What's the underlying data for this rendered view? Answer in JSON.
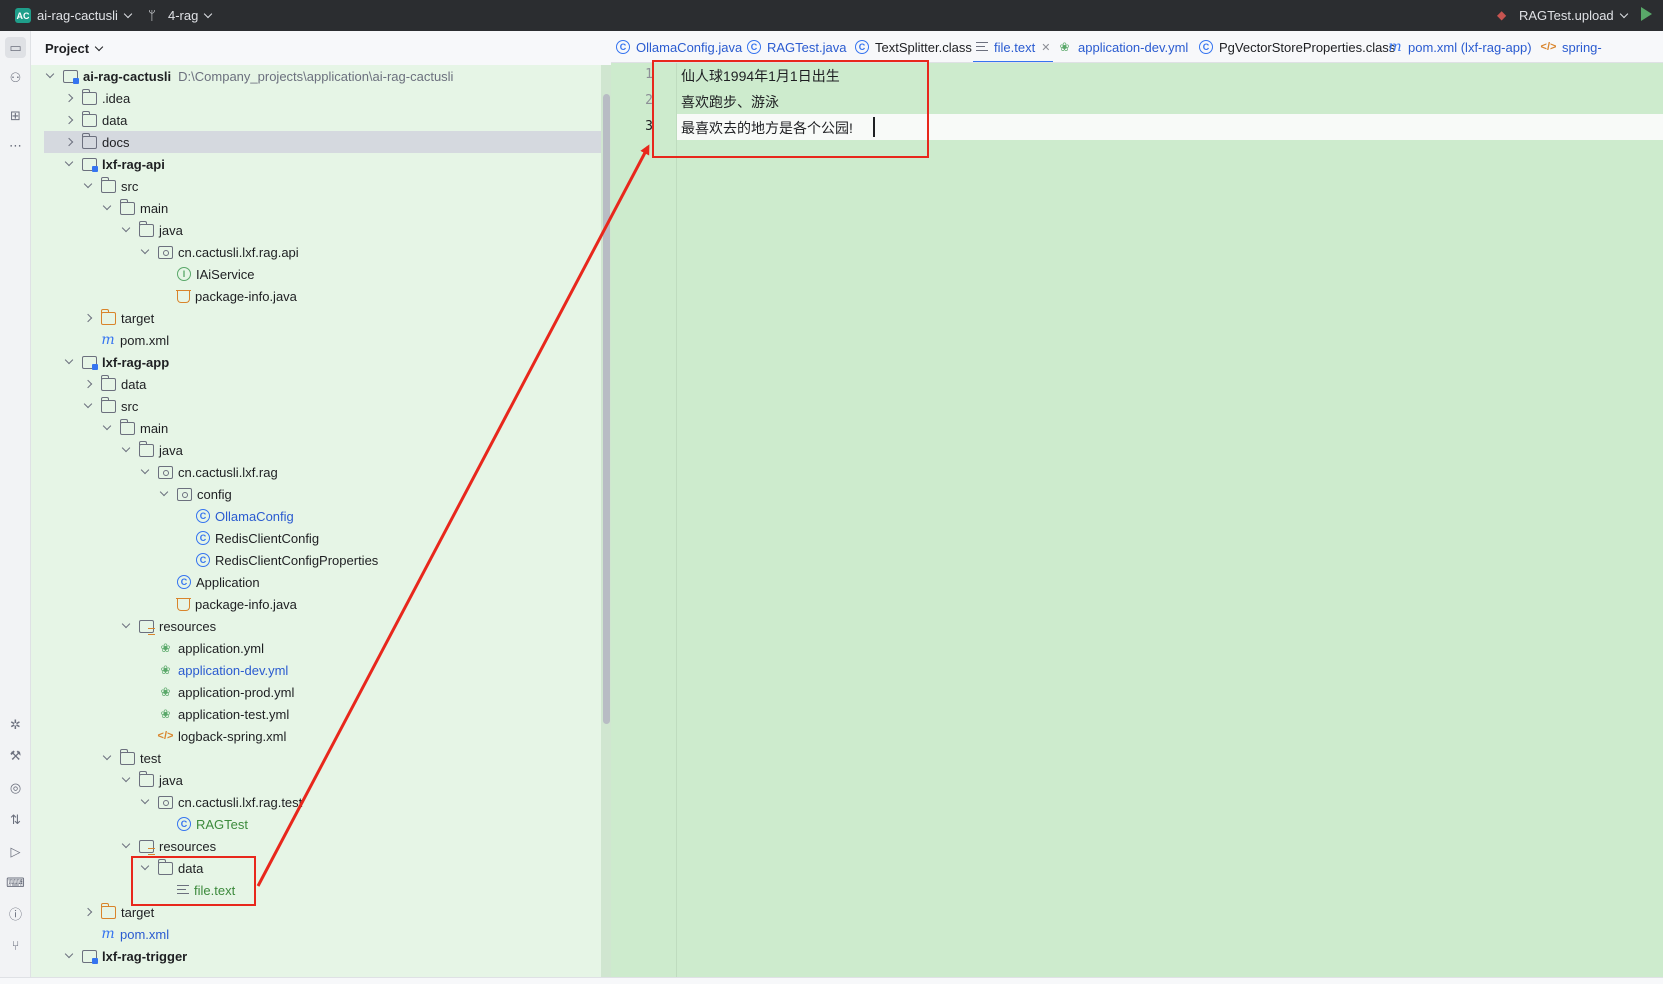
{
  "titlebar": {
    "project_badge": "AC",
    "project_name": "ai-rag-cactusli",
    "branch": "4-rag",
    "run_config": "RAGTest.upload"
  },
  "project_panel": {
    "title": "Project",
    "root_path": "D:\\Company_projects\\application\\ai-rag-cactusli",
    "tree": [
      {
        "label": "ai-rag-cactusli",
        "icon": "module-icon",
        "arrow": "open",
        "bold": true
      },
      {
        "label": ".idea",
        "icon": "folder-icon",
        "arrow": "closed"
      },
      {
        "label": "data",
        "icon": "folder-icon",
        "arrow": "closed"
      },
      {
        "label": "docs",
        "icon": "folder-icon",
        "arrow": "closed",
        "selected": true
      },
      {
        "label": "lxf-rag-api",
        "icon": "module-icon",
        "arrow": "open",
        "bold": true
      },
      {
        "label": "src",
        "icon": "folder-icon",
        "arrow": "open"
      },
      {
        "label": "main",
        "icon": "folder-icon",
        "arrow": "open"
      },
      {
        "label": "java",
        "icon": "folder-icon",
        "arrow": "open"
      },
      {
        "label": "cn.cactusli.lxf.rag.api",
        "icon": "package-icon",
        "arrow": "open"
      },
      {
        "label": "IAiService",
        "icon": "interface-icon",
        "arrow": "none"
      },
      {
        "label": "package-info.java",
        "icon": "java-file-icon",
        "arrow": "none"
      },
      {
        "label": "target",
        "icon": "folder-orange-icon",
        "arrow": "closed"
      },
      {
        "label": "pom.xml",
        "icon": "maven-icon",
        "arrow": "none"
      },
      {
        "label": "lxf-rag-app",
        "icon": "module-icon",
        "arrow": "open",
        "bold": true
      },
      {
        "label": "data",
        "icon": "folder-icon",
        "arrow": "closed"
      },
      {
        "label": "src",
        "icon": "folder-icon",
        "arrow": "open"
      },
      {
        "label": "main",
        "icon": "folder-icon",
        "arrow": "open"
      },
      {
        "label": "java",
        "icon": "folder-icon",
        "arrow": "open"
      },
      {
        "label": "cn.cactusli.lxf.rag",
        "icon": "package-icon",
        "arrow": "open"
      },
      {
        "label": "config",
        "icon": "package-icon",
        "arrow": "open"
      },
      {
        "label": "OllamaConfig",
        "icon": "class-icon",
        "arrow": "none",
        "color": "blue"
      },
      {
        "label": "RedisClientConfig",
        "icon": "class-icon",
        "arrow": "none"
      },
      {
        "label": "RedisClientConfigProperties",
        "icon": "class-icon",
        "arrow": "none"
      },
      {
        "label": "Application",
        "icon": "spring-app-icon",
        "arrow": "none"
      },
      {
        "label": "package-info.java",
        "icon": "java-file-icon",
        "arrow": "none"
      },
      {
        "label": "resources",
        "icon": "resources-icon",
        "arrow": "open"
      },
      {
        "label": "application.yml",
        "icon": "yaml-icon",
        "arrow": "none"
      },
      {
        "label": "application-dev.yml",
        "icon": "yaml-icon",
        "arrow": "none",
        "color": "blue"
      },
      {
        "label": "application-prod.yml",
        "icon": "yaml-icon",
        "arrow": "none"
      },
      {
        "label": "application-test.yml",
        "icon": "yaml-icon",
        "arrow": "none"
      },
      {
        "label": "logback-spring.xml",
        "icon": "xml-icon",
        "arrow": "none"
      },
      {
        "label": "test",
        "icon": "folder-icon",
        "arrow": "open"
      },
      {
        "label": "java",
        "icon": "folder-icon",
        "arrow": "open"
      },
      {
        "label": "cn.cactusli.lxf.rag.test",
        "icon": "package-icon",
        "arrow": "open"
      },
      {
        "label": "RAGTest",
        "icon": "class-icon",
        "arrow": "none",
        "color": "green"
      },
      {
        "label": "resources",
        "icon": "resources-icon",
        "arrow": "open"
      },
      {
        "label": "data",
        "icon": "folder-icon",
        "arrow": "open"
      },
      {
        "label": "file.text",
        "icon": "text-file-icon",
        "arrow": "none",
        "color": "green"
      },
      {
        "label": "target",
        "icon": "folder-orange-icon",
        "arrow": "closed"
      },
      {
        "label": "pom.xml",
        "icon": "maven-icon",
        "arrow": "none",
        "color": "blue"
      },
      {
        "label": "lxf-rag-trigger",
        "icon": "module-icon",
        "arrow": "open",
        "bold": true
      }
    ]
  },
  "editor": {
    "tabs": [
      {
        "label": "OllamaConfig.java",
        "icon": "class-icon",
        "color": "blue"
      },
      {
        "label": "RAGTest.java",
        "icon": "class-icon",
        "color": "blue"
      },
      {
        "label": "TextSplitter.class",
        "icon": "class-icon"
      },
      {
        "label": "file.text",
        "icon": "text-file-icon",
        "active": true,
        "close": "✕"
      },
      {
        "label": "application-dev.yml",
        "icon": "yaml-icon",
        "color": "blue"
      },
      {
        "label": "PgVectorStoreProperties.class",
        "icon": "class-icon"
      },
      {
        "label": "pom.xml (lxf-rag-app)",
        "icon": "maven-icon",
        "color": "blue"
      },
      {
        "label": "spring-",
        "icon": "xml-icon",
        "color": "blue"
      }
    ],
    "line_numbers": [
      "1",
      "2",
      "3"
    ],
    "lines": [
      "仙人球1994年1月1日出生",
      "喜欢跑步、游泳",
      "最喜欢去的地方是各个公园!"
    ]
  },
  "colors": {
    "annotation": "#e8271c",
    "tree_background": "#e6f5e6",
    "editor_background": "#cdebcd",
    "accent": "#3574f0"
  }
}
